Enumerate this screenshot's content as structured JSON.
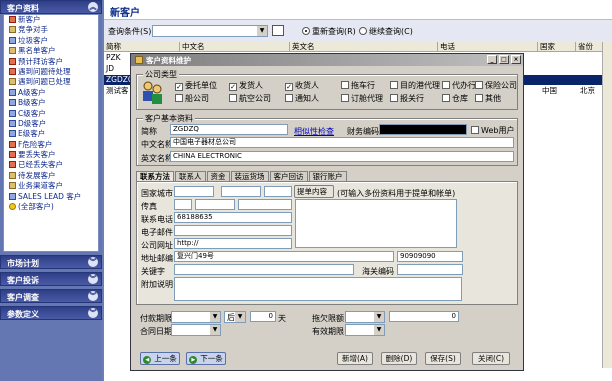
{
  "sidebar": {
    "header": "客户资料",
    "items": [
      "新客户",
      "竞争对手",
      "垃圾客户",
      "黑名单客户",
      "预计拜访客户",
      "遇到问题待处理",
      "遇到问题已处理",
      "A级客户",
      "B级客户",
      "C级客户",
      "D级客户",
      "E级客户",
      "F危险客户",
      "要丢失客户",
      "已经丢失客户",
      "待发展客户",
      "业务渠道客户",
      "SALES LEAD 客户",
      "(全部客户)"
    ],
    "sections": [
      "市场计划",
      "客户投诉",
      "客户调查",
      "参数定义"
    ]
  },
  "main": {
    "title": "新客户",
    "query_label": "查询条件(S)",
    "radio_requery": "重新查询(R)",
    "radio_continue": "继续查询(C)",
    "columns": [
      "简称",
      "中文名",
      "英文名",
      "电话",
      "国家",
      "省份"
    ],
    "rows": [
      {
        "short": "PZK",
        "cn": "",
        "en": "",
        "tel": "",
        "country": "",
        "prov": ""
      },
      {
        "short": "JD",
        "cn": "",
        "en": "",
        "tel": "",
        "country": "",
        "prov": ""
      },
      {
        "short": "ZGDZQ",
        "cn": "",
        "en": "",
        "tel": "",
        "country": "",
        "prov": ""
      },
      {
        "short": "测试客",
        "cn": "",
        "en": "",
        "tel": "",
        "country": "中国",
        "prov": "北京"
      }
    ]
  },
  "dialog": {
    "title": "客户资料维护",
    "company_type_label": "公司类型",
    "types": [
      {
        "label": "委托单位",
        "checked": true
      },
      {
        "label": "发货人",
        "checked": true
      },
      {
        "label": "收货人",
        "checked": true
      },
      {
        "label": "拖车行",
        "checked": false
      },
      {
        "label": "目的港代理",
        "checked": false
      },
      {
        "label": "代办行",
        "checked": false
      },
      {
        "label": "保险公司",
        "checked": false
      },
      {
        "label": "船公司",
        "checked": false
      },
      {
        "label": "航空公司",
        "checked": false
      },
      {
        "label": "通知人",
        "checked": false
      },
      {
        "label": "订舱代理",
        "checked": false
      },
      {
        "label": "报关行",
        "checked": false
      },
      {
        "label": "仓库",
        "checked": false
      },
      {
        "label": "其他",
        "checked": false
      }
    ],
    "basic_label": "客户基本资料",
    "short_label": "简称",
    "short_value": "ZGDZQ",
    "similar_link": "相似性检查",
    "finance_label": "财务编码",
    "web_user": "Web用户",
    "cn_label": "中文名称",
    "cn_value": "中国电子器材总公司",
    "en_label": "英文名称",
    "en_value": "CHINA ELECTRONIC",
    "tabs": [
      "联系方法",
      "联系人",
      "资金",
      "装运货场",
      "客户回访",
      "银行账户"
    ],
    "country_label": "国家城市",
    "fax_label": "传真",
    "phone_label": "联系电话",
    "phone_value": "68188635",
    "email_label": "电子邮件",
    "site_label": "公司网址",
    "site_value": "http://",
    "addr_label": "地址邮编",
    "addr_value": "复兴门49号",
    "zip_value": "90909090",
    "keyword_label": "关键字",
    "customs_label": "海关编码",
    "notes_label": "附加说明",
    "lading_btn": "提单内容",
    "lading_hint": "(可输入多份资料用于提单和帐单)",
    "pay_label": "付款期限",
    "pay_after": "后",
    "pay_days": "0",
    "day_unit": "天",
    "limit_label": "拖欠限额",
    "limit_value": "0",
    "contract_label": "合同日期",
    "valid_label": "有效期限",
    "btn_prev": "上一条",
    "btn_next": "下一条",
    "btn_new": "新增(A)",
    "btn_del": "删除(D)",
    "btn_save": "保存(S)",
    "btn_close": "关闭(C)"
  }
}
